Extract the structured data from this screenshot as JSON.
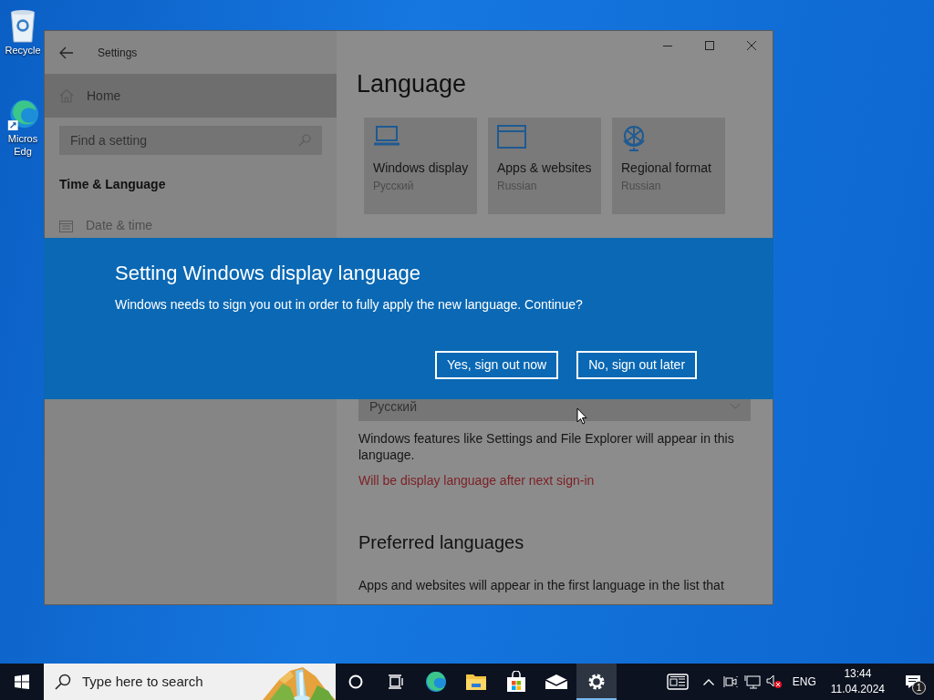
{
  "desktop_icons": [
    {
      "kind": "recycle",
      "lines": [
        "Recycle"
      ]
    },
    {
      "kind": "edge",
      "lines": [
        "Micros",
        "Edg"
      ]
    }
  ],
  "window": {
    "title": "Settings",
    "sidebar": {
      "home": "Home",
      "search_placeholder": "Find a setting",
      "section": "Time & Language",
      "items": [
        {
          "label": "Date & time"
        }
      ]
    },
    "content": {
      "heading": "Language",
      "tiles": [
        {
          "kind": "laptop",
          "title": "Windows display",
          "subtitle": "Русский"
        },
        {
          "kind": "window",
          "title": "Apps & websites",
          "subtitle": "Russian"
        },
        {
          "kind": "globe",
          "title": "Regional format",
          "subtitle": "Russian"
        }
      ],
      "display_dropdown": "Русский",
      "description": "Windows features like Settings and File Explorer will appear in this language.",
      "status": "Will be display language after next sign-in",
      "preferred_heading": "Preferred languages",
      "preferred_text": "Apps and websites will appear in the first language in the list that"
    }
  },
  "dialog": {
    "title": "Setting Windows display language",
    "message": "Windows needs to sign you out in order to fully apply the new language. Continue?",
    "buttons": [
      "Yes, sign out now",
      "No, sign out later"
    ]
  },
  "taskbar": {
    "search_placeholder": "Type here to search",
    "apps": [
      {
        "kind": "cortana",
        "active": false
      },
      {
        "kind": "taskview",
        "active": false
      },
      {
        "kind": "edge",
        "active": false
      },
      {
        "kind": "explorer",
        "active": false
      },
      {
        "kind": "store",
        "active": false
      },
      {
        "kind": "mail",
        "active": false
      },
      {
        "kind": "settings",
        "active": true
      }
    ],
    "language": "ENG",
    "time": "13:44",
    "date": "11.04.2024",
    "notifications": "1"
  }
}
